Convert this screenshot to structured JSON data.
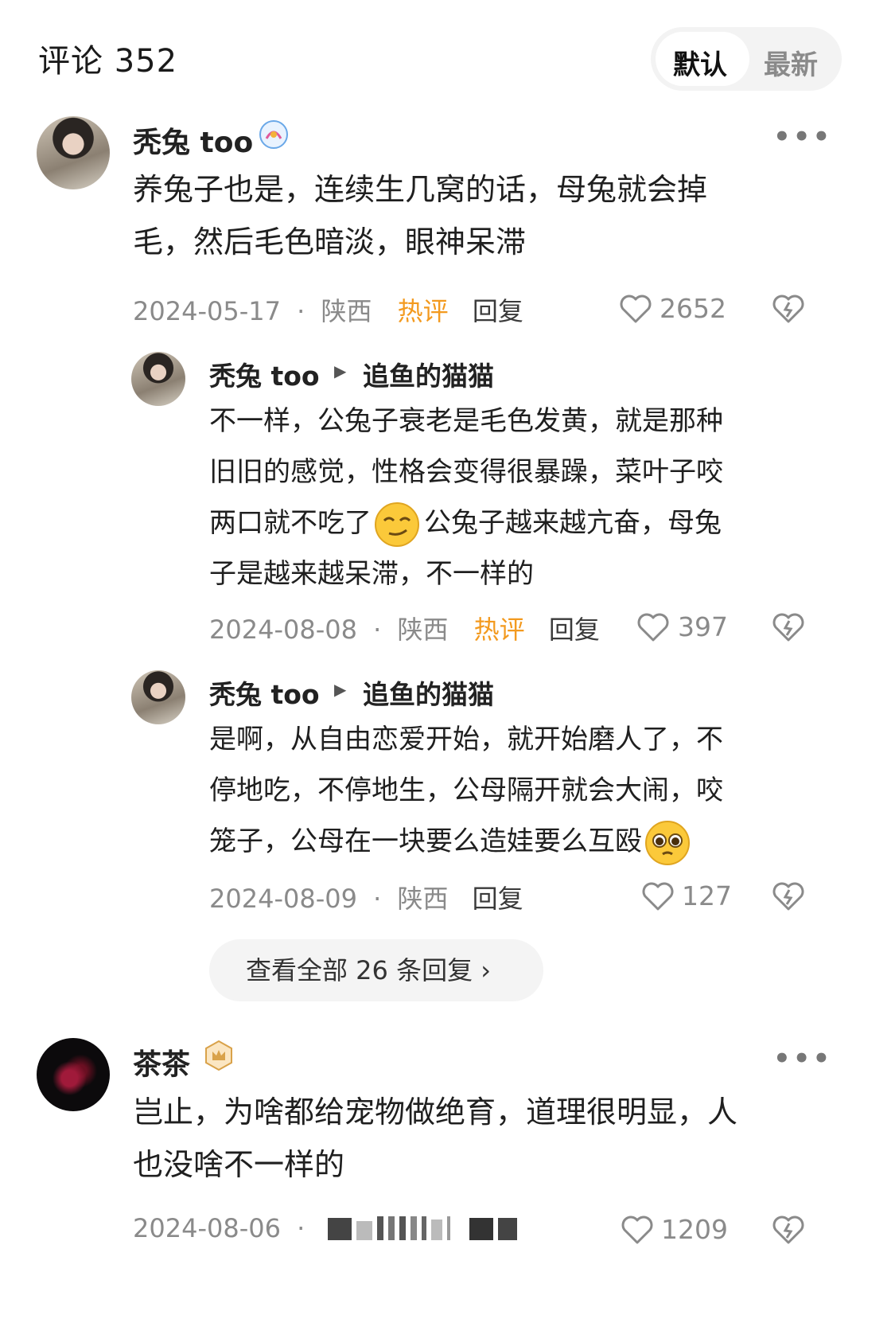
{
  "header": {
    "title": "评论 352",
    "sort_default": "默认",
    "sort_latest": "最新"
  },
  "comments": [
    {
      "user": "秃兔 too",
      "text_line1": "养兔子也是，连续生几窝的话，母兔就会掉",
      "text_line2": "毛，然后毛色暗淡，眼神呆滞",
      "date": "2024-05-17",
      "location": "陕西",
      "tag": "热评",
      "reply_label": "回复",
      "likes": "2652",
      "replies": [
        {
          "user": "秃兔 too",
          "reply_to": "追鱼的猫猫",
          "line1": "不一样，公兔子衰老是毛色发黄，就是那种",
          "line2": "旧旧的感觉，性格会变得很暴躁，菜叶子咬",
          "line3a": "两口就不吃了",
          "line3b": "公兔子越来越亢奋，母兔",
          "line4": "子是越来越呆滞，不一样的",
          "date": "2024-08-08",
          "location": "陕西",
          "tag": "热评",
          "reply_label": "回复",
          "likes": "397"
        },
        {
          "user": "秃兔 too",
          "reply_to": "追鱼的猫猫",
          "line1": "是啊，从自由恋爱开始，就开始磨人了，不",
          "line2": "停地吃，不停地生，公母隔开就会大闹，咬",
          "line3": "笼子，公母在一块要么造娃要么互殴",
          "date": "2024-08-09",
          "location": "陕西",
          "reply_label": "回复",
          "likes": "127"
        }
      ],
      "view_all": "查看全部 26 条回复 ›"
    },
    {
      "user": "茶茶",
      "text_line1": "岂止，为啥都给宠物做绝育，道理很明显，人",
      "text_line2": "也没啥不一样的",
      "date": "2024-08-06",
      "likes": "1209"
    }
  ],
  "separator": "·",
  "more_icon": "•••",
  "colors": {
    "hot": "#f39a1f",
    "meta": "#8a8a8a",
    "text": "#1f1f1f"
  }
}
